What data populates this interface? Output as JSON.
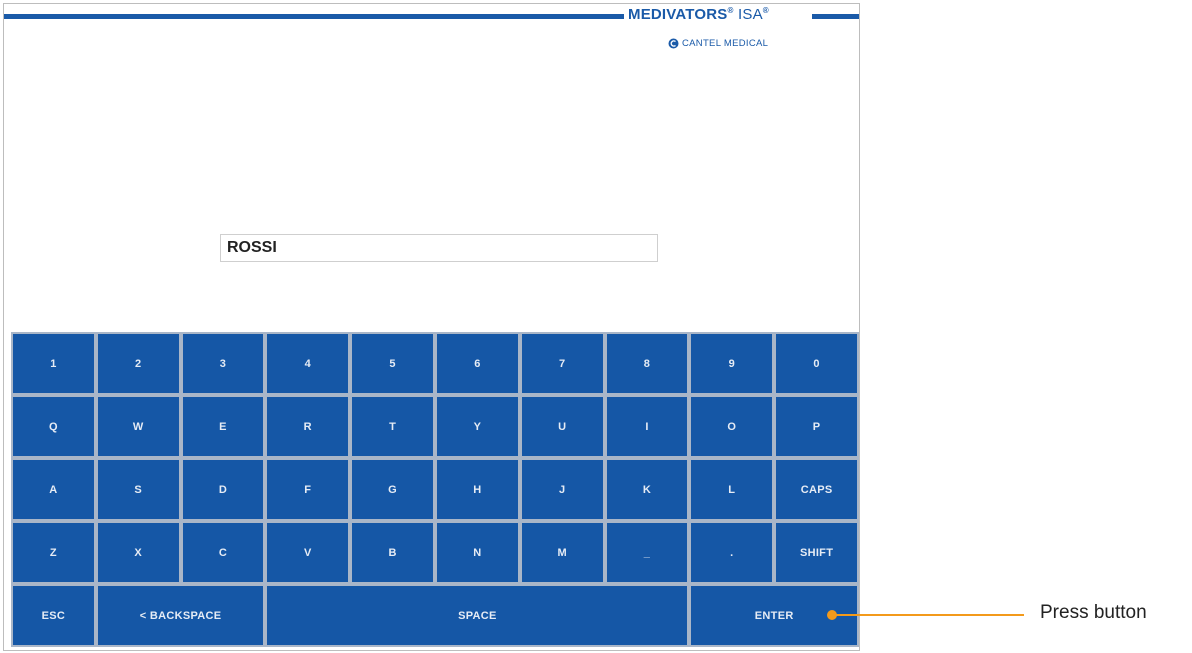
{
  "brand": {
    "name": "MEDIVATORS",
    "reg": "®",
    "product": "ISA",
    "tm": "®",
    "company": "CANTEL MEDICAL"
  },
  "input": {
    "value": "ROSSI"
  },
  "keyboard": {
    "rows": [
      [
        "1",
        "2",
        "3",
        "4",
        "5",
        "6",
        "7",
        "8",
        "9",
        "0"
      ],
      [
        "Q",
        "W",
        "E",
        "R",
        "T",
        "Y",
        "U",
        "I",
        "O",
        "P"
      ],
      [
        "A",
        "S",
        "D",
        "F",
        "G",
        "H",
        "J",
        "K",
        "L",
        "CAPS"
      ],
      [
        "Z",
        "X",
        "C",
        "V",
        "B",
        "N",
        "M",
        "_",
        ".",
        "SHIFT"
      ]
    ],
    "bottom": {
      "esc": "ESC",
      "backspace": "< BACKSPACE",
      "space": "SPACE",
      "enter": "ENTER"
    }
  },
  "callout": {
    "text": "Press button"
  },
  "colors": {
    "key": "#1557a6",
    "brand": "#1a5aa8",
    "callout": "#f39a1b"
  }
}
